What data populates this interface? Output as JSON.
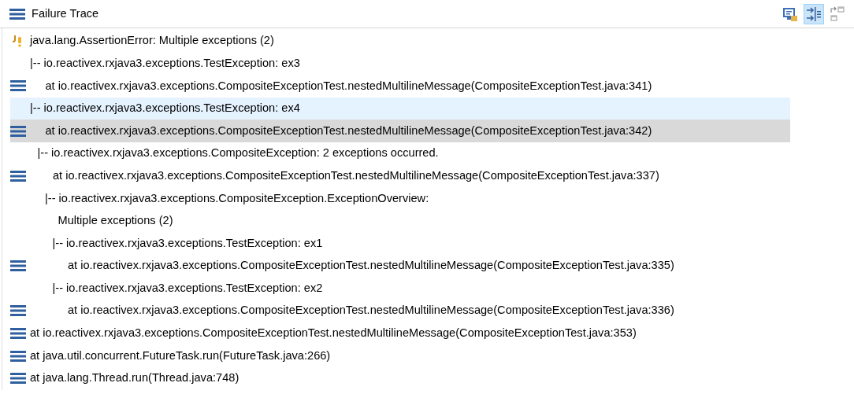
{
  "view": {
    "title": "Failure Trace"
  },
  "toolbar": [
    {
      "kind": "compare",
      "selected": false
    },
    {
      "kind": "filter",
      "selected": true
    },
    {
      "kind": "layout",
      "selected": false
    }
  ],
  "trace": [
    {
      "kind": "failure",
      "text": "java.lang.AssertionError: Multiple exceptions (2)",
      "hovered": false,
      "selected": false,
      "children": [
        {
          "kind": "cause",
          "text": "|-- io.reactivex.rxjava3.exceptions.TestException: ex3",
          "hovered": false,
          "selected": false,
          "children": [
            {
              "kind": "frame",
              "text": "at io.reactivex.rxjava3.exceptions.CompositeExceptionTest.nestedMultilineMessage(CompositeExceptionTest.java:341)",
              "hovered": false,
              "selected": false
            }
          ]
        },
        {
          "kind": "cause",
          "text": "|-- io.reactivex.rxjava3.exceptions.TestException: ex4",
          "hovered": true,
          "selected": false,
          "children": [
            {
              "kind": "frame",
              "text": "at io.reactivex.rxjava3.exceptions.CompositeExceptionTest.nestedMultilineMessage(CompositeExceptionTest.java:342)",
              "hovered": false,
              "selected": true
            },
            {
              "kind": "cause",
              "text": "|-- io.reactivex.rxjava3.exceptions.CompositeException: 2 exceptions occurred.",
              "hovered": false,
              "selected": false,
              "children": [
                {
                  "kind": "frame",
                  "text": "at io.reactivex.rxjava3.exceptions.CompositeExceptionTest.nestedMultilineMessage(CompositeExceptionTest.java:337)",
                  "hovered": false,
                  "selected": false
                },
                {
                  "kind": "cause",
                  "text": "|-- io.reactivex.rxjava3.exceptions.CompositeException.ExceptionOverview:",
                  "hovered": false,
                  "selected": false,
                  "children": [
                    {
                      "kind": "message",
                      "text": "Multiple exceptions (2)",
                      "hovered": false,
                      "selected": false
                    },
                    {
                      "kind": "cause",
                      "text": "|-- io.reactivex.rxjava3.exceptions.TestException: ex1",
                      "hovered": false,
                      "selected": false,
                      "children": [
                        {
                          "kind": "frame",
                          "text": "at io.reactivex.rxjava3.exceptions.CompositeExceptionTest.nestedMultilineMessage(CompositeExceptionTest.java:335)",
                          "hovered": false,
                          "selected": false
                        }
                      ]
                    },
                    {
                      "kind": "cause",
                      "text": "|-- io.reactivex.rxjava3.exceptions.TestException: ex2",
                      "hovered": false,
                      "selected": false,
                      "children": [
                        {
                          "kind": "frame",
                          "text": "at io.reactivex.rxjava3.exceptions.CompositeExceptionTest.nestedMultilineMessage(CompositeExceptionTest.java:336)",
                          "hovered": false,
                          "selected": false
                        }
                      ]
                    }
                  ]
                }
              ]
            }
          ]
        }
      ]
    },
    {
      "kind": "frame",
      "text": "at io.reactivex.rxjava3.exceptions.CompositeExceptionTest.nestedMultilineMessage(CompositeExceptionTest.java:353)",
      "hovered": false,
      "selected": false
    },
    {
      "kind": "frame",
      "text": "at java.util.concurrent.FutureTask.run(FutureTask.java:266)",
      "hovered": false,
      "selected": false
    },
    {
      "kind": "frame",
      "text": "at java.lang.Thread.run(Thread.java:748)",
      "hovered": false,
      "selected": false
    }
  ]
}
